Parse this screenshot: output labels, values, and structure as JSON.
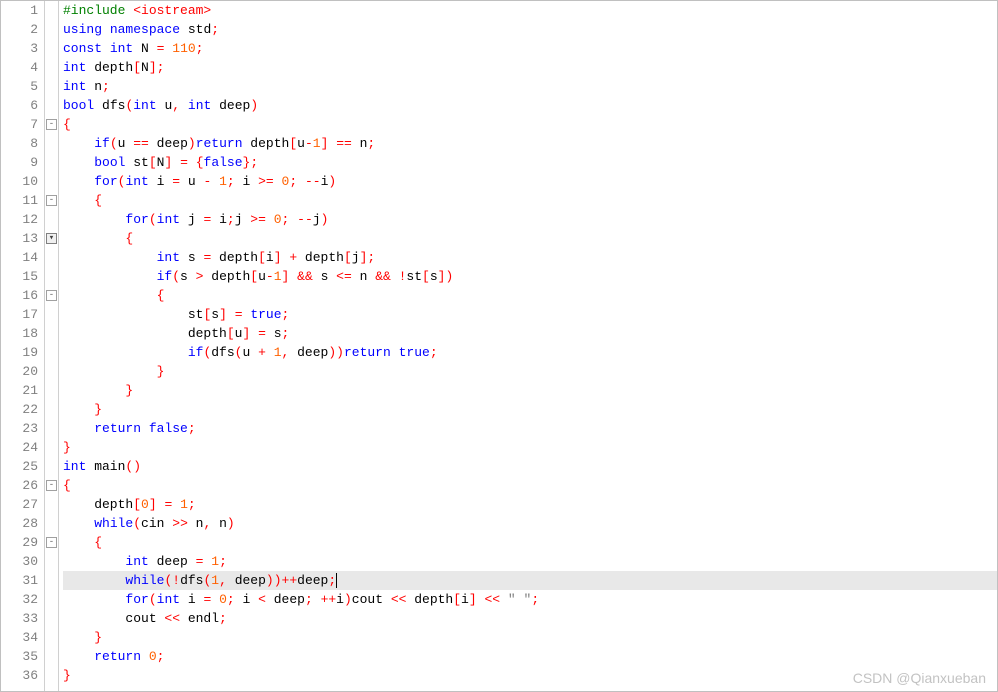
{
  "watermark": "CSDN @Qianxueban",
  "current_line": 31,
  "fold_markers": {
    "7": "▾",
    "11": "▾",
    "13": "▾",
    "16": "▾",
    "26": "▾",
    "29": "▾"
  },
  "fold_dropdown_line": 13,
  "lines": [
    {
      "n": 1,
      "tokens": [
        [
          "pp",
          "#include "
        ],
        [
          "ppinc",
          "<iostream>"
        ]
      ]
    },
    {
      "n": 2,
      "tokens": [
        [
          "kw",
          "using"
        ],
        [
          "pn",
          " "
        ],
        [
          "kw",
          "namespace"
        ],
        [
          "pn",
          " std"
        ],
        [
          "op",
          ";"
        ]
      ]
    },
    {
      "n": 3,
      "tokens": [
        [
          "kw",
          "const"
        ],
        [
          "pn",
          " "
        ],
        [
          "kw",
          "int"
        ],
        [
          "pn",
          " N "
        ],
        [
          "op",
          "="
        ],
        [
          "pn",
          " "
        ],
        [
          "num",
          "110"
        ],
        [
          "op",
          ";"
        ]
      ]
    },
    {
      "n": 4,
      "tokens": [
        [
          "kw",
          "int"
        ],
        [
          "pn",
          " depth"
        ],
        [
          "op",
          "["
        ],
        [
          "pn",
          "N"
        ],
        [
          "op",
          "]"
        ],
        [
          "op",
          ";"
        ]
      ]
    },
    {
      "n": 5,
      "tokens": [
        [
          "kw",
          "int"
        ],
        [
          "pn",
          " n"
        ],
        [
          "op",
          ";"
        ]
      ]
    },
    {
      "n": 6,
      "tokens": [
        [
          "kw",
          "bool"
        ],
        [
          "pn",
          " dfs"
        ],
        [
          "op",
          "("
        ],
        [
          "kw",
          "int"
        ],
        [
          "pn",
          " u"
        ],
        [
          "op",
          ","
        ],
        [
          "pn",
          " "
        ],
        [
          "kw",
          "int"
        ],
        [
          "pn",
          " deep"
        ],
        [
          "op",
          ")"
        ]
      ]
    },
    {
      "n": 7,
      "tokens": [
        [
          "op",
          "{"
        ]
      ]
    },
    {
      "n": 8,
      "tokens": [
        [
          "pn",
          "    "
        ],
        [
          "kw",
          "if"
        ],
        [
          "op",
          "("
        ],
        [
          "pn",
          "u "
        ],
        [
          "op",
          "=="
        ],
        [
          "pn",
          " deep"
        ],
        [
          "op",
          ")"
        ],
        [
          "kw",
          "return"
        ],
        [
          "pn",
          " depth"
        ],
        [
          "op",
          "["
        ],
        [
          "pn",
          "u"
        ],
        [
          "op",
          "-"
        ],
        [
          "num",
          "1"
        ],
        [
          "op",
          "]"
        ],
        [
          "pn",
          " "
        ],
        [
          "op",
          "=="
        ],
        [
          "pn",
          " n"
        ],
        [
          "op",
          ";"
        ]
      ]
    },
    {
      "n": 9,
      "tokens": [
        [
          "pn",
          "    "
        ],
        [
          "kw",
          "bool"
        ],
        [
          "pn",
          " st"
        ],
        [
          "op",
          "["
        ],
        [
          "pn",
          "N"
        ],
        [
          "op",
          "]"
        ],
        [
          "pn",
          " "
        ],
        [
          "op",
          "="
        ],
        [
          "pn",
          " "
        ],
        [
          "op",
          "{"
        ],
        [
          "kw",
          "false"
        ],
        [
          "op",
          "}"
        ],
        [
          "op",
          ";"
        ]
      ]
    },
    {
      "n": 10,
      "tokens": [
        [
          "pn",
          "    "
        ],
        [
          "kw",
          "for"
        ],
        [
          "op",
          "("
        ],
        [
          "kw",
          "int"
        ],
        [
          "pn",
          " i "
        ],
        [
          "op",
          "="
        ],
        [
          "pn",
          " u "
        ],
        [
          "op",
          "-"
        ],
        [
          "pn",
          " "
        ],
        [
          "num",
          "1"
        ],
        [
          "op",
          ";"
        ],
        [
          "pn",
          " i "
        ],
        [
          "op",
          ">="
        ],
        [
          "pn",
          " "
        ],
        [
          "num",
          "0"
        ],
        [
          "op",
          ";"
        ],
        [
          "pn",
          " "
        ],
        [
          "op",
          "--"
        ],
        [
          "pn",
          "i"
        ],
        [
          "op",
          ")"
        ]
      ]
    },
    {
      "n": 11,
      "tokens": [
        [
          "pn",
          "    "
        ],
        [
          "op",
          "{"
        ]
      ]
    },
    {
      "n": 12,
      "tokens": [
        [
          "pn",
          "        "
        ],
        [
          "kw",
          "for"
        ],
        [
          "op",
          "("
        ],
        [
          "kw",
          "int"
        ],
        [
          "pn",
          " j "
        ],
        [
          "op",
          "="
        ],
        [
          "pn",
          " i"
        ],
        [
          "op",
          ";"
        ],
        [
          "pn",
          "j "
        ],
        [
          "op",
          ">="
        ],
        [
          "pn",
          " "
        ],
        [
          "num",
          "0"
        ],
        [
          "op",
          ";"
        ],
        [
          "pn",
          " "
        ],
        [
          "op",
          "--"
        ],
        [
          "pn",
          "j"
        ],
        [
          "op",
          ")"
        ]
      ]
    },
    {
      "n": 13,
      "tokens": [
        [
          "pn",
          "        "
        ],
        [
          "op",
          "{"
        ]
      ]
    },
    {
      "n": 14,
      "tokens": [
        [
          "pn",
          "            "
        ],
        [
          "kw",
          "int"
        ],
        [
          "pn",
          " s "
        ],
        [
          "op",
          "="
        ],
        [
          "pn",
          " depth"
        ],
        [
          "op",
          "["
        ],
        [
          "pn",
          "i"
        ],
        [
          "op",
          "]"
        ],
        [
          "pn",
          " "
        ],
        [
          "op",
          "+"
        ],
        [
          "pn",
          " depth"
        ],
        [
          "op",
          "["
        ],
        [
          "pn",
          "j"
        ],
        [
          "op",
          "]"
        ],
        [
          "op",
          ";"
        ]
      ]
    },
    {
      "n": 15,
      "tokens": [
        [
          "pn",
          "            "
        ],
        [
          "kw",
          "if"
        ],
        [
          "op",
          "("
        ],
        [
          "pn",
          "s "
        ],
        [
          "op",
          ">"
        ],
        [
          "pn",
          " depth"
        ],
        [
          "op",
          "["
        ],
        [
          "pn",
          "u"
        ],
        [
          "op",
          "-"
        ],
        [
          "num",
          "1"
        ],
        [
          "op",
          "]"
        ],
        [
          "pn",
          " "
        ],
        [
          "op",
          "&&"
        ],
        [
          "pn",
          " s "
        ],
        [
          "op",
          "<="
        ],
        [
          "pn",
          " n "
        ],
        [
          "op",
          "&&"
        ],
        [
          "pn",
          " "
        ],
        [
          "op",
          "!"
        ],
        [
          "pn",
          "st"
        ],
        [
          "op",
          "["
        ],
        [
          "pn",
          "s"
        ],
        [
          "op",
          "]"
        ],
        [
          "op",
          ")"
        ]
      ]
    },
    {
      "n": 16,
      "tokens": [
        [
          "pn",
          "            "
        ],
        [
          "op",
          "{"
        ]
      ]
    },
    {
      "n": 17,
      "tokens": [
        [
          "pn",
          "                st"
        ],
        [
          "op",
          "["
        ],
        [
          "pn",
          "s"
        ],
        [
          "op",
          "]"
        ],
        [
          "pn",
          " "
        ],
        [
          "op",
          "="
        ],
        [
          "pn",
          " "
        ],
        [
          "kw",
          "true"
        ],
        [
          "op",
          ";"
        ]
      ]
    },
    {
      "n": 18,
      "tokens": [
        [
          "pn",
          "                depth"
        ],
        [
          "op",
          "["
        ],
        [
          "pn",
          "u"
        ],
        [
          "op",
          "]"
        ],
        [
          "pn",
          " "
        ],
        [
          "op",
          "="
        ],
        [
          "pn",
          " s"
        ],
        [
          "op",
          ";"
        ]
      ]
    },
    {
      "n": 19,
      "tokens": [
        [
          "pn",
          "                "
        ],
        [
          "kw",
          "if"
        ],
        [
          "op",
          "("
        ],
        [
          "pn",
          "dfs"
        ],
        [
          "op",
          "("
        ],
        [
          "pn",
          "u "
        ],
        [
          "op",
          "+"
        ],
        [
          "pn",
          " "
        ],
        [
          "num",
          "1"
        ],
        [
          "op",
          ","
        ],
        [
          "pn",
          " deep"
        ],
        [
          "op",
          ")"
        ],
        [
          "op",
          ")"
        ],
        [
          "kw",
          "return"
        ],
        [
          "pn",
          " "
        ],
        [
          "kw",
          "true"
        ],
        [
          "op",
          ";"
        ]
      ]
    },
    {
      "n": 20,
      "tokens": [
        [
          "pn",
          "            "
        ],
        [
          "op",
          "}"
        ]
      ]
    },
    {
      "n": 21,
      "tokens": [
        [
          "pn",
          "        "
        ],
        [
          "op",
          "}"
        ]
      ]
    },
    {
      "n": 22,
      "tokens": [
        [
          "pn",
          "    "
        ],
        [
          "op",
          "}"
        ]
      ]
    },
    {
      "n": 23,
      "tokens": [
        [
          "pn",
          "    "
        ],
        [
          "kw",
          "return"
        ],
        [
          "pn",
          " "
        ],
        [
          "kw",
          "false"
        ],
        [
          "op",
          ";"
        ]
      ]
    },
    {
      "n": 24,
      "tokens": [
        [
          "op",
          "}"
        ]
      ]
    },
    {
      "n": 25,
      "tokens": [
        [
          "kw",
          "int"
        ],
        [
          "pn",
          " main"
        ],
        [
          "op",
          "("
        ],
        [
          "op",
          ")"
        ]
      ]
    },
    {
      "n": 26,
      "tokens": [
        [
          "op",
          "{"
        ]
      ]
    },
    {
      "n": 27,
      "tokens": [
        [
          "pn",
          "    depth"
        ],
        [
          "op",
          "["
        ],
        [
          "num",
          "0"
        ],
        [
          "op",
          "]"
        ],
        [
          "pn",
          " "
        ],
        [
          "op",
          "="
        ],
        [
          "pn",
          " "
        ],
        [
          "num",
          "1"
        ],
        [
          "op",
          ";"
        ]
      ]
    },
    {
      "n": 28,
      "tokens": [
        [
          "pn",
          "    "
        ],
        [
          "kw",
          "while"
        ],
        [
          "op",
          "("
        ],
        [
          "pn",
          "cin "
        ],
        [
          "op",
          ">>"
        ],
        [
          "pn",
          " n"
        ],
        [
          "op",
          ","
        ],
        [
          "pn",
          " n"
        ],
        [
          "op",
          ")"
        ]
      ]
    },
    {
      "n": 29,
      "tokens": [
        [
          "pn",
          "    "
        ],
        [
          "op",
          "{"
        ]
      ]
    },
    {
      "n": 30,
      "tokens": [
        [
          "pn",
          "        "
        ],
        [
          "kw",
          "int"
        ],
        [
          "pn",
          " deep "
        ],
        [
          "op",
          "="
        ],
        [
          "pn",
          " "
        ],
        [
          "num",
          "1"
        ],
        [
          "op",
          ";"
        ]
      ]
    },
    {
      "n": 31,
      "tokens": [
        [
          "pn",
          "        "
        ],
        [
          "kw",
          "while"
        ],
        [
          "op",
          "("
        ],
        [
          "op",
          "!"
        ],
        [
          "pn",
          "dfs"
        ],
        [
          "op",
          "("
        ],
        [
          "num",
          "1"
        ],
        [
          "op",
          ","
        ],
        [
          "pn",
          " deep"
        ],
        [
          "op",
          ")"
        ],
        [
          "op",
          ")"
        ],
        [
          "op",
          "++"
        ],
        [
          "pn",
          "deep"
        ],
        [
          "op",
          ";"
        ]
      ]
    },
    {
      "n": 32,
      "tokens": [
        [
          "pn",
          "        "
        ],
        [
          "kw",
          "for"
        ],
        [
          "op",
          "("
        ],
        [
          "kw",
          "int"
        ],
        [
          "pn",
          " i "
        ],
        [
          "op",
          "="
        ],
        [
          "pn",
          " "
        ],
        [
          "num",
          "0"
        ],
        [
          "op",
          ";"
        ],
        [
          "pn",
          " i "
        ],
        [
          "op",
          "<"
        ],
        [
          "pn",
          " deep"
        ],
        [
          "op",
          ";"
        ],
        [
          "pn",
          " "
        ],
        [
          "op",
          "++"
        ],
        [
          "pn",
          "i"
        ],
        [
          "op",
          ")"
        ],
        [
          "pn",
          "cout "
        ],
        [
          "op",
          "<<"
        ],
        [
          "pn",
          " depth"
        ],
        [
          "op",
          "["
        ],
        [
          "pn",
          "i"
        ],
        [
          "op",
          "]"
        ],
        [
          "pn",
          " "
        ],
        [
          "op",
          "<<"
        ],
        [
          "pn",
          " "
        ],
        [
          "str",
          "\" \""
        ],
        [
          "op",
          ";"
        ]
      ]
    },
    {
      "n": 33,
      "tokens": [
        [
          "pn",
          "        cout "
        ],
        [
          "op",
          "<<"
        ],
        [
          "pn",
          " endl"
        ],
        [
          "op",
          ";"
        ]
      ]
    },
    {
      "n": 34,
      "tokens": [
        [
          "pn",
          "    "
        ],
        [
          "op",
          "}"
        ]
      ]
    },
    {
      "n": 35,
      "tokens": [
        [
          "pn",
          "    "
        ],
        [
          "kw",
          "return"
        ],
        [
          "pn",
          " "
        ],
        [
          "num",
          "0"
        ],
        [
          "op",
          ";"
        ]
      ]
    },
    {
      "n": 36,
      "tokens": [
        [
          "op",
          "}"
        ]
      ]
    }
  ]
}
